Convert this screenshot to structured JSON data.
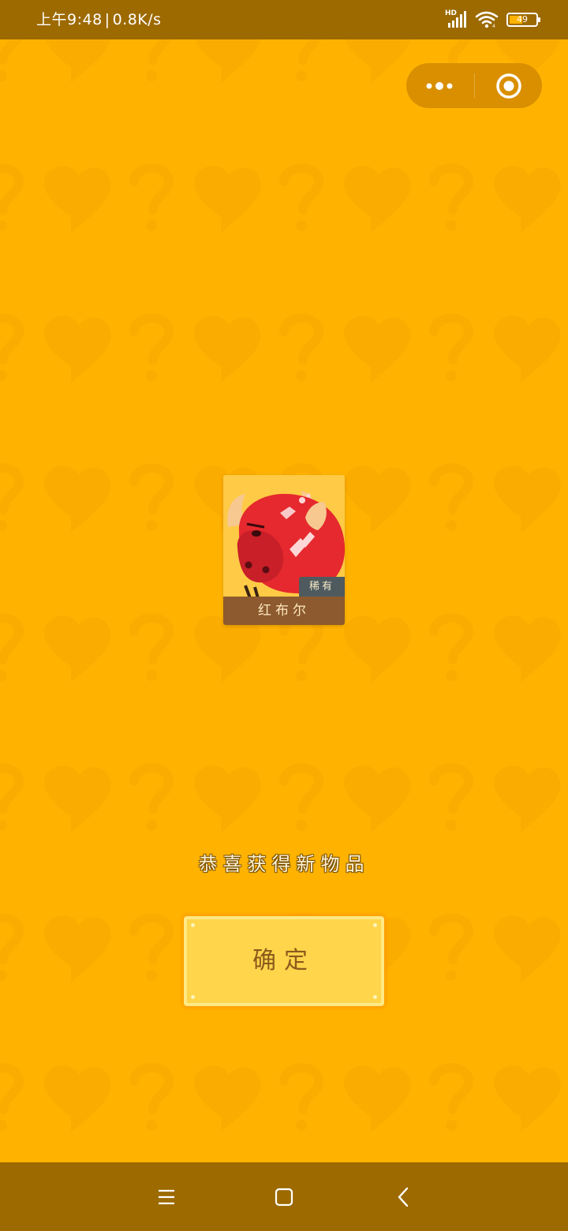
{
  "status_bar": {
    "time": "上午9:48",
    "separator": "|",
    "network_speed": "0.8K/s",
    "signal_label": "HD",
    "battery_level": "49",
    "battery_fraction": 0.49
  },
  "capsule": {
    "more_icon": "more-dots-icon",
    "close_icon": "record-circle-icon"
  },
  "item_card": {
    "image": "red-bull-icon",
    "rarity": "稀有",
    "name": "红布尔"
  },
  "message": "恭喜获得新物品",
  "confirm_button": {
    "label": "确定"
  },
  "nav_bar": {
    "menu_icon": "menu-icon",
    "home_icon": "home-square-icon",
    "back_icon": "back-chevron-icon"
  },
  "colors": {
    "background": "#ffb300",
    "bar": "#9d6a00",
    "button": "#ffd54b",
    "item_name_bar": "#8c5a2e"
  }
}
